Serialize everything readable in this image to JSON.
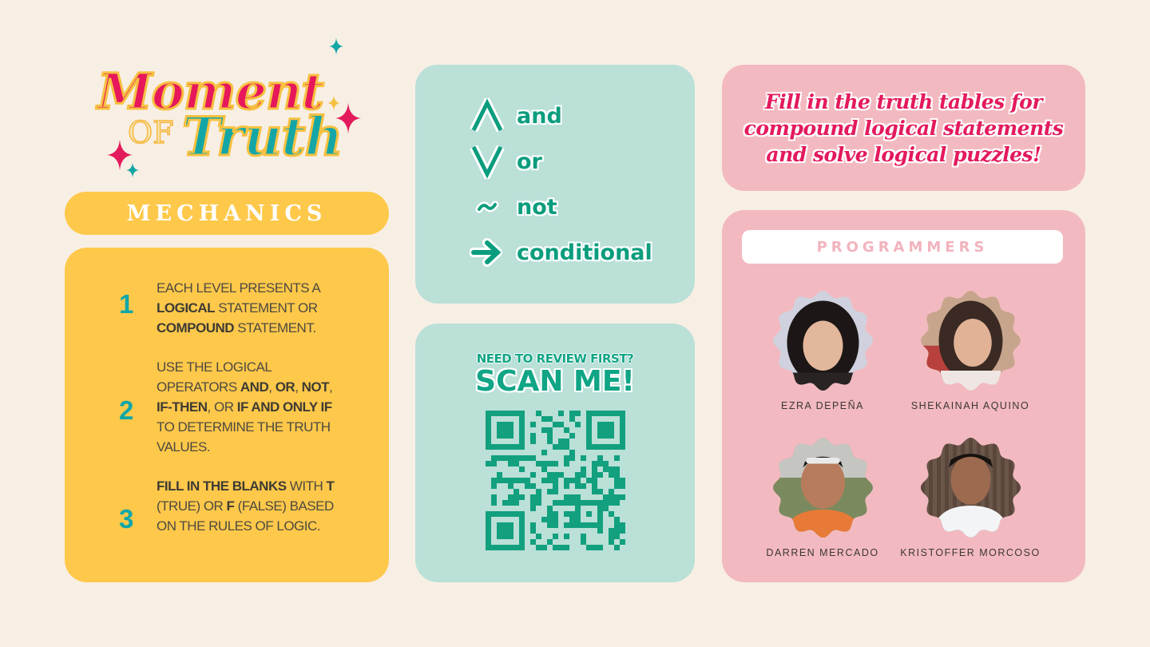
{
  "logo": {
    "word1": "Moment",
    "word2": "OF",
    "word3": "Truth"
  },
  "mechanics": {
    "title": "MECHANICS",
    "steps": [
      {
        "num": "1",
        "parts": [
          {
            "t": "EACH LEVEL PRESENTS A "
          },
          {
            "t": "LOGICAL",
            "b": true
          },
          {
            "t": " STATEMENT OR "
          },
          {
            "t": "COMPOUND",
            "b": true
          },
          {
            "t": " STATEMENT."
          }
        ]
      },
      {
        "num": "2",
        "parts": [
          {
            "t": "USE THE LOGICAL OPERATORS "
          },
          {
            "t": "AND",
            "b": true
          },
          {
            "t": ", "
          },
          {
            "t": "OR",
            "b": true
          },
          {
            "t": ", "
          },
          {
            "t": "NOT",
            "b": true
          },
          {
            "t": ", "
          },
          {
            "t": "IF-THEN",
            "b": true
          },
          {
            "t": ", OR "
          },
          {
            "t": "IF AND ONLY IF",
            "b": true
          },
          {
            "t": " TO DETERMINE THE TRUTH VALUES."
          }
        ]
      },
      {
        "num": "3",
        "parts": [
          {
            "t": "FILL IN THE BLANKS",
            "b": true
          },
          {
            "t": " WITH "
          },
          {
            "t": "T",
            "b": true
          },
          {
            "t": " (TRUE) OR "
          },
          {
            "t": "F",
            "b": true
          },
          {
            "t": " (FALSE) BASED ON THE RULES OF LOGIC."
          }
        ]
      }
    ]
  },
  "operators": [
    {
      "symbol": "and-wedge-icon",
      "label": "and"
    },
    {
      "symbol": "or-vee-icon",
      "label": "or"
    },
    {
      "symbol": "not-tilde-icon",
      "label": "not"
    },
    {
      "symbol": "conditional-arrow-icon",
      "label": "conditional"
    }
  ],
  "review": {
    "prompt": "NEED TO REVIEW FIRST?",
    "cta": "SCAN ME!"
  },
  "tagline": "Fill in the truth tables for compound logical statements and solve logical puzzles!",
  "programmers": {
    "title": "PROGRAMMERS",
    "people": [
      {
        "name": "EZRA DEPEÑA"
      },
      {
        "name": "SHEKAINAH AQUINO"
      },
      {
        "name": "DARREN MERCADO"
      },
      {
        "name": "KRISTOFFER MORCOSO"
      }
    ]
  },
  "colors": {
    "background": "#f8efe4",
    "yellow": "#fec84a",
    "mint": "#bae0d8",
    "pink": "#f2bac0",
    "teal": "#0ea7a8",
    "green": "#0a9d7d",
    "magenta": "#e31a5c"
  }
}
